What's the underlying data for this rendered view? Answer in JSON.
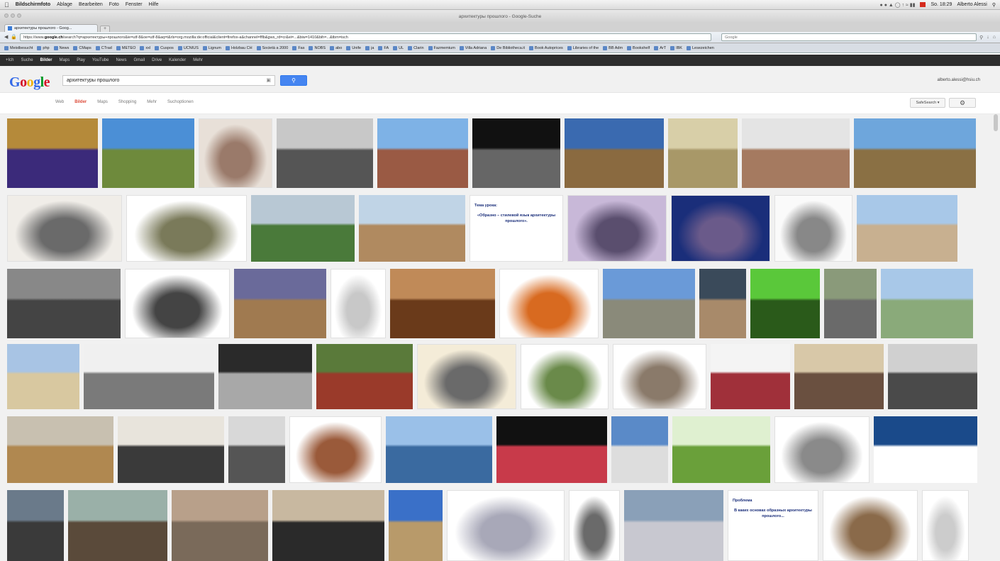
{
  "menubar": {
    "app": "Bildschirmfoto",
    "items": [
      "Ablage",
      "Bearbeiten",
      "Foto",
      "Fenster",
      "Hilfe"
    ],
    "clock": "So. 18:29",
    "user": "Alberto Alessi"
  },
  "window": {
    "title": "архитектуры прошлого - Google-Suche"
  },
  "tabs": [
    {
      "label": "архитектуры прошлого - Goog..."
    }
  ],
  "toolbar": {
    "url_prefix": "https://www.",
    "url_host": "google.ch",
    "url_rest": "/search?q=архитектуры+прошлого&ie=utf-8&oe=utf-8&aq=t&rls=org.mozilla:de:official&client=firefox-a&channel=fflb&gws_rd=cr&ei=...&biw=1410&bih=...&tbm=isch",
    "search_placeholder": "Google"
  },
  "bookmarks": [
    "Meistbesucht",
    "php",
    "News",
    "CMaps",
    "CTrad",
    "METEO",
    "xxl",
    "Cuspos",
    "UCNIUS",
    "Lignum",
    "Holzbau CH",
    "Società a 2000",
    "Fas",
    "NOBS",
    "abo",
    "Unife",
    "ja",
    "FA",
    "UL",
    "Clarin",
    "Fazmemium",
    "Villa Adriana",
    "De Bibliotheca.it",
    "Book Autoprices",
    "Libraries of the",
    "BB Adm",
    "Bookshelf",
    "ArT",
    "IBK",
    "Lesezeichen"
  ],
  "gbar": {
    "items": [
      "+Ich",
      "Suche",
      "Bilder",
      "Maps",
      "Play",
      "YouTube",
      "News",
      "Gmail",
      "Drive",
      "Kalender",
      "Mehr"
    ],
    "active": "Bilder"
  },
  "search": {
    "query": "архитектуры прошлого",
    "account": "alberto.alessi@hsiu.ch"
  },
  "subnav": {
    "links": [
      "Web",
      "Bilder",
      "Maps",
      "Shopping",
      "Mehr",
      "Suchoptionen"
    ],
    "selected": "Bilder",
    "safesearch": "SafeSearch"
  },
  "thumbs": [
    {
      "text": "Тема урока:",
      "text2": "«Образно – стилевой язык архитектуры прошлого»."
    },
    {
      "text": "Проблема",
      "text2": "В каких основах образных архитектуры прошлого..."
    }
  ],
  "colors": {
    "google_blue": "#4585f1",
    "google_red": "#dd4b39",
    "gbar_bg": "#2d2d2d"
  }
}
